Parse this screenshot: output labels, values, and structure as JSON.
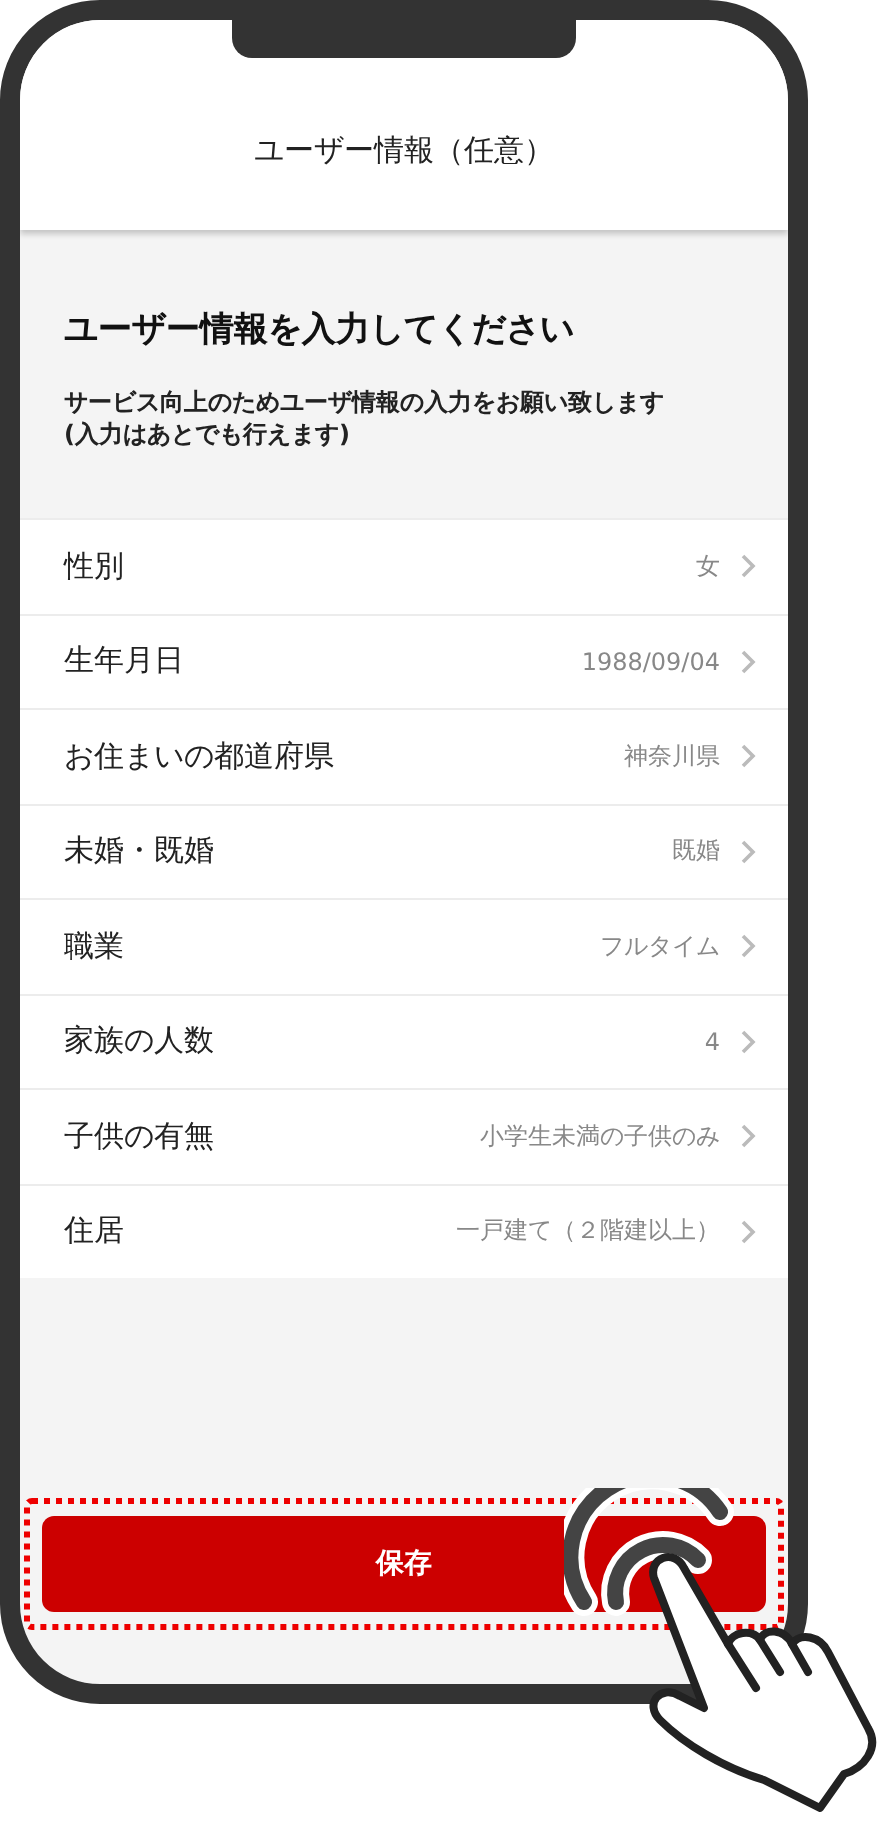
{
  "header": {
    "title": "ユーザー情報（任意）"
  },
  "intro": {
    "heading": "ユーザー情報を入力してください",
    "description": "サービス向上のためユーザ情報の入力をお願い致します\n(入力はあとでも行えます)"
  },
  "fields": [
    {
      "label": "性別",
      "value": "女"
    },
    {
      "label": "生年月日",
      "value": "1988/09/04"
    },
    {
      "label": "お住まいの都道府県",
      "value": "神奈川県"
    },
    {
      "label": "未婚・既婚",
      "value": "既婚"
    },
    {
      "label": "職業",
      "value": "フルタイム"
    },
    {
      "label": "家族の人数",
      "value": "4"
    },
    {
      "label": "子供の有無",
      "value": "小学生未満の子供のみ"
    },
    {
      "label": "住居",
      "value": "一戸建て（２階建以上）"
    }
  ],
  "save_button": {
    "label": "保存"
  }
}
